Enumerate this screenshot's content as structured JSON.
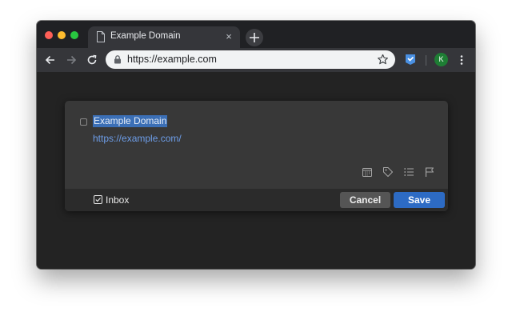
{
  "browser": {
    "tab": {
      "title": "Example Domain",
      "close_glyph": "×"
    },
    "new_tab_icon": "plus-icon",
    "omnibox": {
      "url": "https://example.com",
      "lock_icon": "lock-icon",
      "bookmark_icon": "star-icon"
    },
    "extension_icon": "todoist-icon",
    "profile": {
      "initial": "K",
      "color": "#1e7e34"
    },
    "menu_icon": "more-vertical-icon"
  },
  "quick_add": {
    "task_title": "Example Domain",
    "task_url": "https://example.com/",
    "tools": [
      "calendar-icon",
      "tag-icon",
      "list-icon",
      "flag-icon"
    ],
    "project": {
      "label": "Inbox",
      "icon": "inbox-checkbox-icon"
    },
    "buttons": {
      "cancel": "Cancel",
      "save": "Save"
    },
    "colors": {
      "accent": "#2d6bc4",
      "selection": "#3b6fb6",
      "link": "#6d9de8"
    }
  }
}
